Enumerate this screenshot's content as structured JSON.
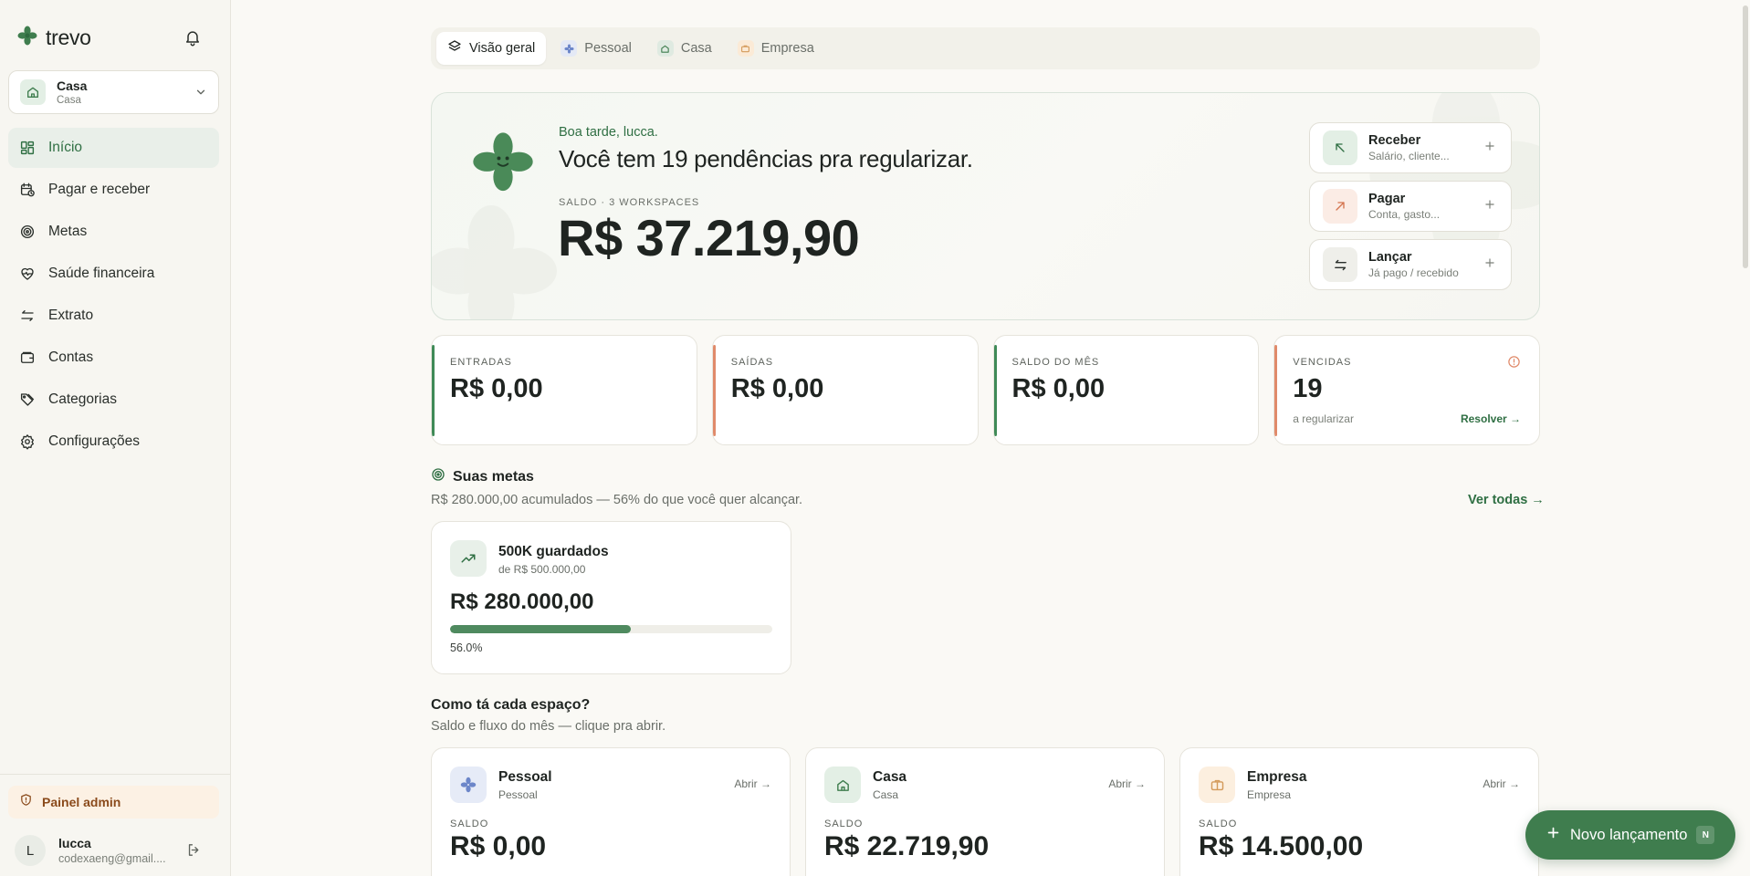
{
  "brand": {
    "name": "trevo"
  },
  "workspace": {
    "name": "Casa",
    "type": "Casa"
  },
  "nav": {
    "items": [
      {
        "label": "Início"
      },
      {
        "label": "Pagar e receber"
      },
      {
        "label": "Metas"
      },
      {
        "label": "Saúde financeira"
      },
      {
        "label": "Extrato"
      },
      {
        "label": "Contas"
      },
      {
        "label": "Categorias"
      },
      {
        "label": "Configurações"
      }
    ]
  },
  "admin": {
    "label": "Painel admin"
  },
  "user": {
    "initial": "L",
    "name": "lucca",
    "email": "codexaeng@gmail...."
  },
  "tabs": [
    {
      "label": "Visão geral"
    },
    {
      "label": "Pessoal"
    },
    {
      "label": "Casa"
    },
    {
      "label": "Empresa"
    }
  ],
  "hero": {
    "greeting": "Boa tarde, lucca.",
    "headline": "Você tem 19 pendências pra regularizar.",
    "balance_label": "SALDO · 3 WORKSPACES",
    "balance_value": "R$ 37.219,90",
    "actions": [
      {
        "title": "Receber",
        "subtitle": "Salário, cliente..."
      },
      {
        "title": "Pagar",
        "subtitle": "Conta, gasto..."
      },
      {
        "title": "Lançar",
        "subtitle": "Já pago / recebido"
      }
    ]
  },
  "stats": [
    {
      "label": "ENTRADAS",
      "value": "R$ 0,00",
      "color": "#3f8a57"
    },
    {
      "label": "SAÍDAS",
      "value": "R$ 0,00",
      "color": "#e08a6a"
    },
    {
      "label": "SALDO DO MÊS",
      "value": "R$ 0,00",
      "color": "#3f8a57"
    },
    {
      "label": "VENCIDAS",
      "value": "19",
      "sub": "a regularizar",
      "link": "Resolver →",
      "color": "#e08a6a"
    }
  ],
  "metas": {
    "title": "Suas metas",
    "summary": "R$ 280.000,00 acumulados — 56% do que você quer alcançar.",
    "view_all": "Ver todas →",
    "goal": {
      "title": "500K guardados",
      "target": "de R$ 500.000,00",
      "value": "R$ 280.000,00",
      "progress": 0.56,
      "progress_label": "56.0%"
    }
  },
  "spaces_section": {
    "title": "Como tá cada espaço?",
    "subtitle": "Saldo e fluxo do mês — clique pra abrir.",
    "open_label": "Abrir →",
    "balance_label": "SALDO",
    "spaces": [
      {
        "name": "Pessoal",
        "type": "Pessoal",
        "value": "R$ 0,00"
      },
      {
        "name": "Casa",
        "type": "Casa",
        "value": "R$ 22.719,90"
      },
      {
        "name": "Empresa",
        "type": "Empresa",
        "value": "R$ 14.500,00"
      }
    ]
  },
  "fab": {
    "label": "Novo lançamento",
    "shortcut": "N"
  },
  "colors": {
    "primary": "#3f7d4e",
    "accent_green": "#2f6f43",
    "warning": "#e08a6a"
  }
}
